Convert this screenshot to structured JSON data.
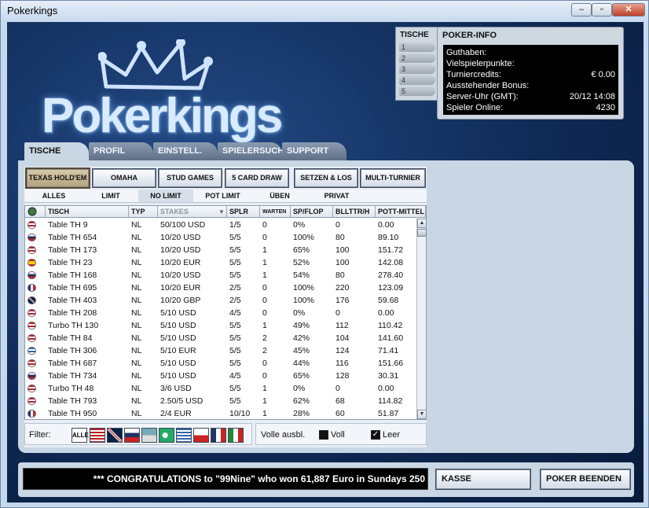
{
  "window": {
    "title": "Pokerkings",
    "min": "–",
    "max": "▫",
    "close": "✕"
  },
  "logo": {
    "text": "Pokerkings"
  },
  "side_tab": {
    "label": "TISCHE",
    "nums": [
      "1",
      "2",
      "3",
      "4",
      "5"
    ]
  },
  "poker_info": {
    "title": "POKER-INFO",
    "rows": [
      {
        "label": "Guthaben:",
        "value": ""
      },
      {
        "label": "Vielspielerpunkte:",
        "value": ""
      },
      {
        "label": "Turniercredits:",
        "value": "€ 0.00"
      },
      {
        "label": "Ausstehender Bonus:",
        "value": ""
      },
      {
        "label": "Server-Uhr (GMT):",
        "value": "20/12 14:08"
      },
      {
        "label": "Spieler Online:",
        "value": "4230"
      }
    ]
  },
  "tabs": [
    "TISCHE",
    "PROFIL",
    "EINSTELL.",
    "SPIELERSUCHE",
    "SUPPORT"
  ],
  "game_buttons": [
    "TEXAS HOLD'EM",
    "OMAHA",
    "STUD GAMES",
    "5 CARD DRAW",
    "SETZEN & LOS",
    "MULTI-TURNIER"
  ],
  "sub_filters": [
    "ALLES",
    "LIMIT",
    "NO LIMIT",
    "POT LIMIT",
    "ÜBEN",
    "PRIVAT"
  ],
  "columns": [
    "TISCH",
    "TYP",
    "STAKES",
    "SPLR",
    "WARTEN",
    "SP/FLOP",
    "BLLTTR/H",
    "POTT-MITTEL"
  ],
  "rows": [
    {
      "flag": "us",
      "tisch": "Table TH 9",
      "typ": "NL",
      "stakes": "50/100 USD",
      "splr": "1/5",
      "warten": "0",
      "spflop": "0%",
      "bh": "0",
      "pott": "0.00"
    },
    {
      "flag": "ru",
      "tisch": "Table TH 654",
      "typ": "NL",
      "stakes": "10/20 USD",
      "splr": "5/5",
      "warten": "0",
      "spflop": "100%",
      "bh": "80",
      "pott": "89.10"
    },
    {
      "flag": "us",
      "tisch": "Table TH 173",
      "typ": "NL",
      "stakes": "10/20 USD",
      "splr": "5/5",
      "warten": "1",
      "spflop": "65%",
      "bh": "100",
      "pott": "151.72"
    },
    {
      "flag": "es",
      "tisch": "Table TH 23",
      "typ": "NL",
      "stakes": "10/20 EUR",
      "splr": "5/5",
      "warten": "1",
      "spflop": "52%",
      "bh": "100",
      "pott": "142.08"
    },
    {
      "flag": "ru",
      "tisch": "Table TH 168",
      "typ": "NL",
      "stakes": "10/20 USD",
      "splr": "5/5",
      "warten": "1",
      "spflop": "54%",
      "bh": "80",
      "pott": "278.40"
    },
    {
      "flag": "fr",
      "tisch": "Table TH 695",
      "typ": "NL",
      "stakes": "10/20 EUR",
      "splr": "2/5",
      "warten": "0",
      "spflop": "100%",
      "bh": "220",
      "pott": "123.09"
    },
    {
      "flag": "gb",
      "tisch": "Table TH 403",
      "typ": "NL",
      "stakes": "10/20 GBP",
      "splr": "2/5",
      "warten": "0",
      "spflop": "100%",
      "bh": "176",
      "pott": "59.68"
    },
    {
      "flag": "us",
      "tisch": "Table TH 208",
      "typ": "NL",
      "stakes": "5/10 USD",
      "splr": "4/5",
      "warten": "0",
      "spflop": "0%",
      "bh": "0",
      "pott": "0.00"
    },
    {
      "flag": "us",
      "tisch": "Turbo TH 130",
      "typ": "NL",
      "stakes": "5/10 USD",
      "splr": "5/5",
      "warten": "1",
      "spflop": "49%",
      "bh": "112",
      "pott": "110.42"
    },
    {
      "flag": "us",
      "tisch": "Table TH 84",
      "typ": "NL",
      "stakes": "5/10 USD",
      "splr": "5/5",
      "warten": "2",
      "spflop": "42%",
      "bh": "104",
      "pott": "141.60"
    },
    {
      "flag": "gr",
      "tisch": "Table TH 306",
      "typ": "NL",
      "stakes": "5/10 EUR",
      "splr": "5/5",
      "warten": "2",
      "spflop": "45%",
      "bh": "124",
      "pott": "71.41"
    },
    {
      "flag": "us",
      "tisch": "Table TH 687",
      "typ": "NL",
      "stakes": "5/10 USD",
      "splr": "5/5",
      "warten": "0",
      "spflop": "44%",
      "bh": "116",
      "pott": "151.66"
    },
    {
      "flag": "ru",
      "tisch": "Table TH 734",
      "typ": "NL",
      "stakes": "5/10 USD",
      "splr": "4/5",
      "warten": "0",
      "spflop": "65%",
      "bh": "128",
      "pott": "30.31"
    },
    {
      "flag": "us",
      "tisch": "Turbo TH 48",
      "typ": "NL",
      "stakes": "3/6 USD",
      "splr": "5/5",
      "warten": "1",
      "spflop": "0%",
      "bh": "0",
      "pott": "0.00"
    },
    {
      "flag": "us",
      "tisch": "Table TH 793",
      "typ": "NL",
      "stakes": "2.50/5 USD",
      "splr": "5/5",
      "warten": "1",
      "spflop": "62%",
      "bh": "68",
      "pott": "114.82"
    },
    {
      "flag": "fr",
      "tisch": "Table TH 950",
      "typ": "NL",
      "stakes": "2/4 EUR",
      "splr": "10/10",
      "warten": "1",
      "spflop": "28%",
      "bh": "60",
      "pott": "51.87"
    }
  ],
  "filter": {
    "label": "Filter:",
    "alle": "ALLE",
    "volle_label": "Volle ausbl.",
    "voll": "Voll",
    "leer": "Leer",
    "voll_checked": false,
    "leer_checked": true
  },
  "ticker": "*** CONGRATULATIONS to \"99Nine\" who won 61,887 Euro in Sundays 250",
  "kasse": "KASSE",
  "beenden": "POKER BEENDEN",
  "colors": {
    "bg": "#0f2a55",
    "panel": "#c9d6e4",
    "accent_sel": "#b5a37f"
  }
}
